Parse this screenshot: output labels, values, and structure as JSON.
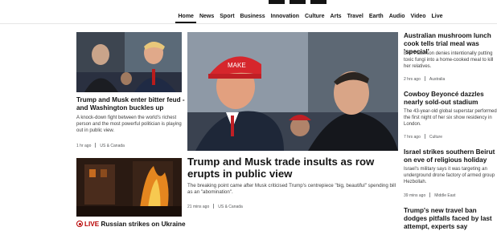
{
  "nav": {
    "items": [
      "Home",
      "News",
      "Sport",
      "Business",
      "Innovation",
      "Culture",
      "Arts",
      "Travel",
      "Earth",
      "Audio",
      "Video",
      "Live"
    ],
    "active": "Home"
  },
  "left_top": {
    "headline": "Trump and Musk enter bitter feud - and Washington buckles up",
    "summary": "A knock-down fight between the world's richest person and the most powerful politician is playing out in public view.",
    "time": "1 hr ago",
    "section": "US & Canada"
  },
  "left_bottom": {
    "live_label": "LIVE",
    "headline": "Russian strikes on Ukraine"
  },
  "main": {
    "headline": "Trump and Musk trade insults as row erupts in public view",
    "summary": "The breaking point came after Musk criticised Trump's centrepiece \"big, beautiful\" spending bill as an \"abomination\".",
    "time": "21 mins ago",
    "section": "US & Canada"
  },
  "right": [
    {
      "headline": "Australian mushroom lunch cook tells trial meal was 'special'",
      "summary": "Erin Patterson denies intentionally putting toxic fungi into a home-cooked meal to kill her relatives.",
      "time": "2 hrs ago",
      "section": "Australia"
    },
    {
      "headline": "Cowboy Beyoncé dazzles nearly sold-out stadium",
      "summary": "The 43-year-old global superstar performed the first night of her six show residency in London.",
      "time": "7 hrs ago",
      "section": "Culture"
    },
    {
      "headline": "Israel strikes southern Beirut on eve of religious holiday",
      "summary": "Israel's military says it was targeting an underground drone factory of armed group Hezbollah.",
      "time": "39 mins ago",
      "section": "Middle East"
    },
    {
      "headline": "Trump's new travel ban dodges pitfalls faced by last attempt, experts say"
    }
  ],
  "colors": {
    "live": "#b80000",
    "text": "#141414",
    "meta": "#545658"
  }
}
